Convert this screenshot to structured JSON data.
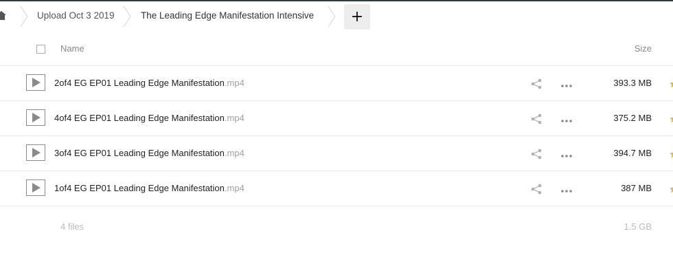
{
  "breadcrumb": {
    "items": [
      {
        "label": "Upload Oct 3 2019"
      },
      {
        "label": "The Leading Edge Manifestation Intensive"
      }
    ],
    "add_label": "+"
  },
  "header": {
    "name_label": "Name",
    "size_label": "Size"
  },
  "files": [
    {
      "base": "2of4 EG EP01 Leading Edge Manifestation",
      "ext": ".mp4",
      "size": "393.3 MB",
      "icon": "video-play-icon"
    },
    {
      "base": "4of4 EG EP01 Leading Edge Manifestation",
      "ext": ".mp4",
      "size": "375.2 MB",
      "icon": "video-play-icon"
    },
    {
      "base": "3of4 EG EP01 Leading Edge Manifestation",
      "ext": ".mp4",
      "size": "394.7 MB",
      "icon": "video-play-icon"
    },
    {
      "base": "1of4 EG EP01 Leading Edge Manifestation",
      "ext": ".mp4",
      "size": "387 MB",
      "icon": "video-play-icon"
    }
  ],
  "summary": {
    "count": "4 files",
    "total_size": "1.5 GB"
  },
  "colors": {
    "top_bar": "#2f3a44",
    "icon_gray": "#9a9a9a",
    "muted_text": "#bbbbbb",
    "favorite": "#f2b01e"
  }
}
